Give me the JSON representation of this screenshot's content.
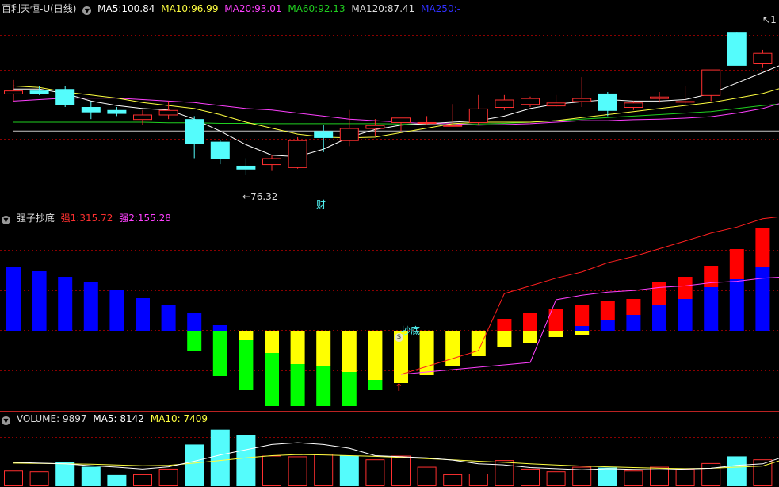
{
  "colors": {
    "up": "#ff3030",
    "down": "#54fcfc",
    "ma5": "#ffffff",
    "ma10": "#ffff40",
    "ma20": "#ff40ff",
    "ma60": "#20d020",
    "ma120": "#c8c8c8",
    "ma250": "#3030ff",
    "red": "#ff0000",
    "blue": "#0000ff",
    "yellow": "#ffff00",
    "green": "#00ff00",
    "grid": "#8b0000"
  },
  "price_panel": {
    "title": "百利天恒-U(日线)",
    "ma5_label": "MA5:",
    "ma5_value": "100.84",
    "ma10_label": "MA10:",
    "ma10_value": "96.99",
    "ma20_label": "MA20:",
    "ma20_value": "93.01",
    "ma60_label": "MA60:",
    "ma60_value": "92.13",
    "ma120_label": "MA120:",
    "ma120_value": "87.41",
    "ma250_label": "MA250:",
    "ma250_value": "-",
    "low_marker": "76.32",
    "finance_marker": "财",
    "top_marker": "1"
  },
  "indicator_panel": {
    "title": "强子抄底",
    "q1_label": "强1:",
    "q1_value": "315.72",
    "q2_label": "强2:",
    "q2_value": "155.28",
    "signal_text": "抄底",
    "coin_icon_text": "$"
  },
  "volume_panel": {
    "vol_label": "VOLUME:",
    "vol_value": "9897",
    "ma5_label": "MA5:",
    "ma5_value": "8142",
    "ma10_label": "MA10:",
    "ma10_value": "7409"
  },
  "chart_data": [
    {
      "type": "candlestick",
      "ylim": [
        70,
        128
      ],
      "candles": [
        {
          "o": 103.5,
          "h": 108,
          "l": 101,
          "c": 104.5
        },
        {
          "o": 104.5,
          "h": 106,
          "l": 103,
          "c": 103.5
        },
        {
          "o": 105,
          "h": 106,
          "l": 99,
          "c": 100
        },
        {
          "o": 99,
          "h": 101,
          "l": 95,
          "c": 97.5
        },
        {
          "o": 98,
          "h": 99,
          "l": 96,
          "c": 97
        },
        {
          "o": 95,
          "h": 98,
          "l": 93,
          "c": 96.5
        },
        {
          "o": 96.5,
          "h": 101,
          "l": 95,
          "c": 98
        },
        {
          "o": 95,
          "h": 96,
          "l": 82,
          "c": 87
        },
        {
          "o": 87.5,
          "h": 88,
          "l": 80,
          "c": 82
        },
        {
          "o": 79.5,
          "h": 82,
          "l": 76.32,
          "c": 78.5
        },
        {
          "o": 80,
          "h": 83,
          "l": 78,
          "c": 82
        },
        {
          "o": 79,
          "h": 89,
          "l": 78.5,
          "c": 88
        },
        {
          "o": 91,
          "h": 93,
          "l": 84,
          "c": 89
        },
        {
          "o": 88,
          "h": 98,
          "l": 86,
          "c": 92
        },
        {
          "o": 92,
          "h": 95,
          "l": 89.5,
          "c": 93
        },
        {
          "o": 94,
          "h": 95,
          "l": 91,
          "c": 95.5
        },
        {
          "o": 94,
          "h": 96,
          "l": 93,
          "c": 94
        },
        {
          "o": 93,
          "h": 100,
          "l": 92.5,
          "c": 93
        },
        {
          "o": 94,
          "h": 103,
          "l": 93,
          "c": 98.5
        },
        {
          "o": 99,
          "h": 103,
          "l": 98,
          "c": 101.5
        },
        {
          "o": 100,
          "h": 102.5,
          "l": 99,
          "c": 102
        },
        {
          "o": 99.5,
          "h": 103,
          "l": 99,
          "c": 100.5
        },
        {
          "o": 101,
          "h": 109,
          "l": 99,
          "c": 102
        },
        {
          "o": 103.5,
          "h": 104,
          "l": 96,
          "c": 98
        },
        {
          "o": 99,
          "h": 101,
          "l": 98,
          "c": 100.5
        },
        {
          "o": 102,
          "h": 104,
          "l": 100.5,
          "c": 102.5
        },
        {
          "o": 101,
          "h": 106,
          "l": 99.5,
          "c": 101
        },
        {
          "o": 103,
          "h": 107,
          "l": 101,
          "c": 111.5
        },
        {
          "o": 124,
          "h": 124,
          "l": 113,
          "c": 113
        },
        {
          "o": 113.5,
          "h": 118,
          "l": 112,
          "c": 117
        },
        {
          "o": 117.5,
          "h": 128,
          "l": 116.5,
          "c": 126.5
        }
      ],
      "ma_lines": {
        "ma5": [
          105,
          105,
          103.5,
          101,
          99.5,
          98.5,
          98,
          95,
          91,
          86.5,
          83,
          82.5,
          85,
          89,
          91.5,
          93,
          93.5,
          94,
          94.5,
          96,
          98.5,
          100,
          100.8,
          101.5,
          101,
          101,
          101.5,
          103.5,
          107,
          110.5,
          114
        ],
        "ma10": [
          106,
          105.5,
          104,
          103,
          102,
          100.5,
          99.5,
          98.5,
          96.5,
          94,
          92,
          90,
          89,
          88.8,
          89,
          90.5,
          92,
          93.5,
          94,
          94,
          94,
          94.5,
          95.5,
          96.5,
          97.5,
          98.5,
          99.5,
          100.5,
          102,
          103.5,
          106
        ],
        "ma20": [
          101,
          101.5,
          102,
          102,
          102,
          101.5,
          101,
          100.5,
          99.5,
          98.5,
          98,
          97,
          96,
          95,
          94.5,
          94,
          93.5,
          93.5,
          93,
          93.2,
          93.5,
          94,
          94.5,
          94.5,
          94.8,
          95,
          95.3,
          95.8,
          97,
          98.5,
          101
        ],
        "ma60": [
          94,
          94,
          94,
          94,
          94,
          94,
          93.8,
          93.8,
          93.6,
          93.6,
          93.5,
          93.5,
          93.5,
          93.5,
          93.5,
          93.4,
          93.4,
          93.4,
          93.4,
          93.6,
          94,
          94.5,
          95,
          95.5,
          96,
          96.5,
          97,
          97.5,
          98.5,
          99.5,
          100.3
        ],
        "ma120": [
          91,
          91,
          91,
          91,
          91,
          91,
          91,
          91,
          91,
          91,
          91,
          91,
          91,
          91,
          91,
          91,
          91,
          91,
          91,
          91,
          91,
          91,
          91,
          91,
          91,
          91,
          91,
          91,
          91,
          91,
          91
        ]
      }
    },
    {
      "type": "bar",
      "ylim": [
        -90,
        120
      ],
      "q1": [
        null,
        null,
        null,
        null,
        null,
        null,
        null,
        null,
        null,
        null,
        null,
        null,
        null,
        null,
        null,
        55,
        58,
        62,
        90,
        120,
        145,
        170,
        190,
        220,
        240,
        265,
        290,
        315.72,
        335,
        362,
        372
      ],
      "q2": [
        75,
        72,
        68,
        64,
        57,
        48,
        40,
        26,
        12,
        null,
        null,
        null,
        null,
        null,
        null,
        15,
        18,
        22,
        40,
        60,
        80,
        100,
        115,
        125,
        130,
        140,
        145,
        155.28,
        160,
        170,
        175
      ],
      "neg": [
        null,
        null,
        null,
        null,
        null,
        null,
        null,
        null,
        null,
        null,
        null,
        null,
        null,
        null,
        null,
        55,
        55,
        60,
        62,
        62,
        60,
        58,
        55,
        50,
        45,
        30,
        20,
        null,
        null,
        null,
        null
      ],
      "bars": [
        {
          "blue": 80
        },
        {
          "blue": 75
        },
        {
          "blue": 68
        },
        {
          "blue": 62
        },
        {
          "blue": 51
        },
        {
          "blue": 41
        },
        {
          "blue": 33
        },
        {
          "blue": 22,
          "green": -25
        },
        {
          "blue": 7,
          "green": -57
        },
        {
          "yellow": -12,
          "green": -75
        },
        {
          "yellow": -28,
          "green": -95
        },
        {
          "yellow": -42,
          "green": -95
        },
        {
          "yellow": -45,
          "green": -95
        },
        {
          "yellow": -52,
          "green": -95
        },
        {
          "yellow": -62,
          "green": -75
        },
        {
          "yellow": -66
        },
        {
          "yellow": -56
        },
        {
          "yellow": -45
        },
        {
          "yellow": -32
        },
        {
          "yellow": -20,
          "red": 15
        },
        {
          "yellow": -15,
          "red": 22
        },
        {
          "yellow": -8,
          "red": 28
        },
        {
          "yellow": -5,
          "blue": 6,
          "red": 33
        },
        {
          "blue": 13,
          "red": 38
        },
        {
          "blue": 20,
          "red": 40
        },
        {
          "blue": 32,
          "red": 62
        },
        {
          "blue": 40,
          "red": 68
        },
        {
          "blue": 55,
          "red": 82
        },
        {
          "blue": 65,
          "red": 103
        },
        {
          "blue": 80,
          "red": 130
        }
      ]
    },
    {
      "type": "bar",
      "ylim": [
        0,
        16000
      ],
      "volume": [
        {
          "v": 4000,
          "up": true
        },
        {
          "v": 3800,
          "up": true
        },
        {
          "v": 6300,
          "up": false
        },
        {
          "v": 5000,
          "up": false
        },
        {
          "v": 2800,
          "up": false
        },
        {
          "v": 3000,
          "up": true
        },
        {
          "v": 4500,
          "up": true
        },
        {
          "v": 11000,
          "up": false
        },
        {
          "v": 15000,
          "up": false
        },
        {
          "v": 13500,
          "up": false
        },
        {
          "v": 8000,
          "up": true
        },
        {
          "v": 7800,
          "up": true
        },
        {
          "v": 8500,
          "up": true
        },
        {
          "v": 8000,
          "up": false
        },
        {
          "v": 7000,
          "up": true
        },
        {
          "v": 8000,
          "up": true
        },
        {
          "v": 5000,
          "up": true
        },
        {
          "v": 3000,
          "up": true
        },
        {
          "v": 3200,
          "up": true
        },
        {
          "v": 6800,
          "up": true
        },
        {
          "v": 4500,
          "up": true
        },
        {
          "v": 3800,
          "up": true
        },
        {
          "v": 5000,
          "up": true
        },
        {
          "v": 4800,
          "up": false
        },
        {
          "v": 4000,
          "up": true
        },
        {
          "v": 5000,
          "up": true
        },
        {
          "v": 4500,
          "up": true
        },
        {
          "v": 6000,
          "up": true
        },
        {
          "v": 7800,
          "up": false
        },
        {
          "v": 7000,
          "up": true
        },
        {
          "v": 9897,
          "up": true
        }
      ],
      "ma5": [
        6200,
        6000,
        5800,
        5300,
        4900,
        4400,
        5000,
        6500,
        8200,
        9600,
        11000,
        11500,
        11000,
        10000,
        8000,
        7700,
        7400,
        6800,
        5800,
        5500,
        4800,
        4500,
        4200,
        4500,
        4300,
        4200,
        4400,
        4600,
        5400,
        5800,
        8142
      ],
      "ma10": [
        6000,
        5900,
        5800,
        5700,
        5500,
        5300,
        5400,
        6000,
        6700,
        7400,
        8000,
        8300,
        8200,
        8000,
        7800,
        7500,
        7200,
        6900,
        6500,
        6200,
        5800,
        5500,
        5200,
        5000,
        4800,
        4600,
        4500,
        4600,
        4900,
        5200,
        7409
      ]
    }
  ]
}
